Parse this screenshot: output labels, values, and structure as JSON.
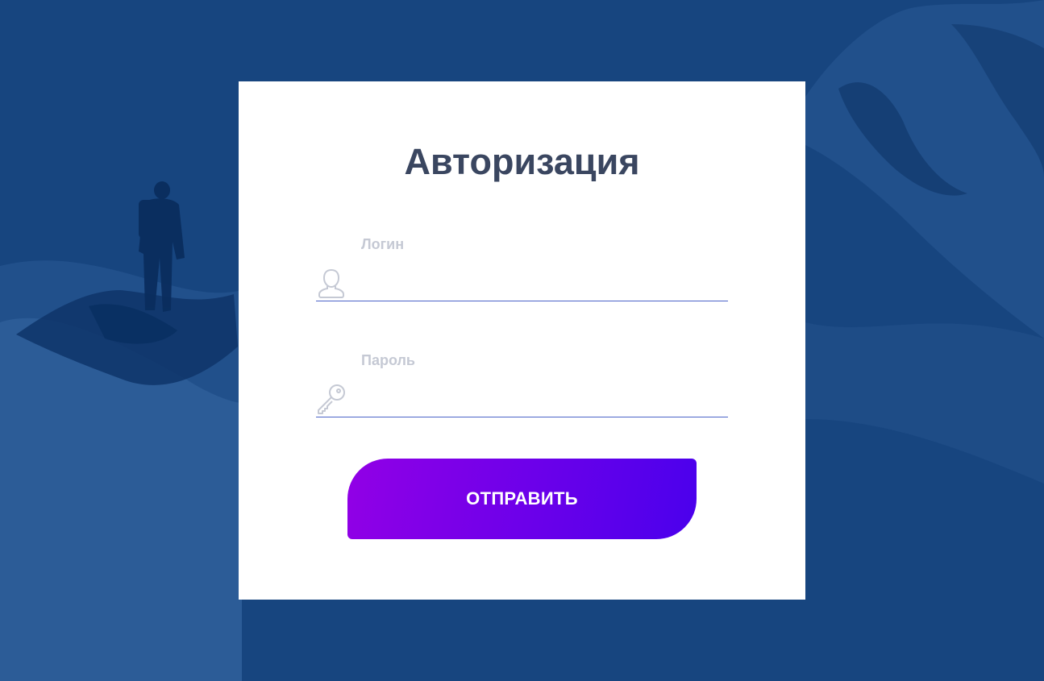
{
  "form": {
    "title": "Авторизация",
    "login": {
      "label": "Логин",
      "value": "",
      "icon": "user-icon"
    },
    "password": {
      "label": "Пароль",
      "value": "",
      "icon": "key-icon"
    },
    "submit_label": "ОТПРАВИТЬ"
  },
  "colors": {
    "background": "#17457f",
    "card": "#ffffff",
    "title": "#3a4660",
    "label": "#c5c9d4",
    "underline": "#4b63c8",
    "button_start": "#9200e6",
    "button_end": "#4a00ec"
  }
}
